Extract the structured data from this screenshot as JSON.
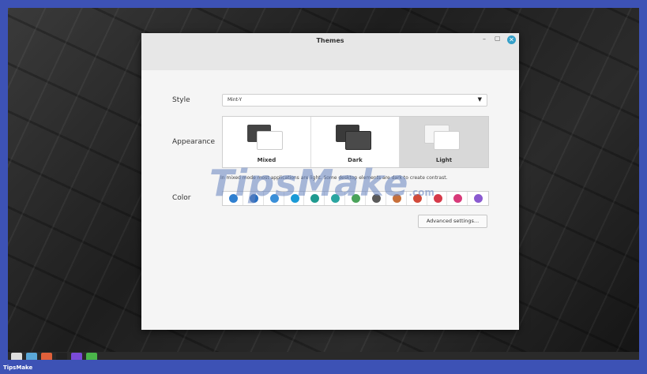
{
  "window": {
    "title": "Themes",
    "minimize_glyph": "–",
    "maximize_glyph": "▢",
    "close_glyph": "✕"
  },
  "style": {
    "label": "Style",
    "selected": "Mint-Y",
    "dropdown_icon": "chevron-down-icon"
  },
  "appearance": {
    "label": "Appearance",
    "options": [
      {
        "label": "Mixed",
        "selected": false,
        "back_color": "#444444",
        "front_color": "#ffffff"
      },
      {
        "label": "Dark",
        "selected": false,
        "back_color": "#3a3a3a",
        "front_color": "#4a4a4a"
      },
      {
        "label": "Light",
        "selected": true,
        "back_color": "#f5f5f5",
        "front_color": "#ffffff"
      }
    ]
  },
  "info_text": "In mixed mode most applications are light. Some desktop elements are dark to create contrast.",
  "color": {
    "label": "Color",
    "swatches": [
      "#2f7fd0",
      "#2a6fc0",
      "#3a8fd8",
      "#1a9ad6",
      "#1f9a8f",
      "#2aa5a0",
      "#4aa35a",
      "#5a5a5a",
      "#c8703a",
      "#d24a3a",
      "#d63a4a",
      "#d83a7a",
      "#8a5ad0"
    ]
  },
  "advanced_button": "Advanced settings...",
  "watermark": {
    "text": "TipsMake",
    "suffix": ".com"
  },
  "footer": {
    "brand": "TipsMake"
  },
  "taskbar": {
    "items": [
      {
        "name": "menu",
        "color": "#dddddd"
      },
      {
        "name": "files",
        "color": "#5aa8d8"
      },
      {
        "name": "app-orange",
        "color": "#e0603a"
      },
      {
        "name": "terminal",
        "color": "#222222"
      },
      {
        "name": "app-purple",
        "color": "#7a4ad8"
      },
      {
        "name": "app-green",
        "color": "#4ab54a"
      }
    ]
  }
}
